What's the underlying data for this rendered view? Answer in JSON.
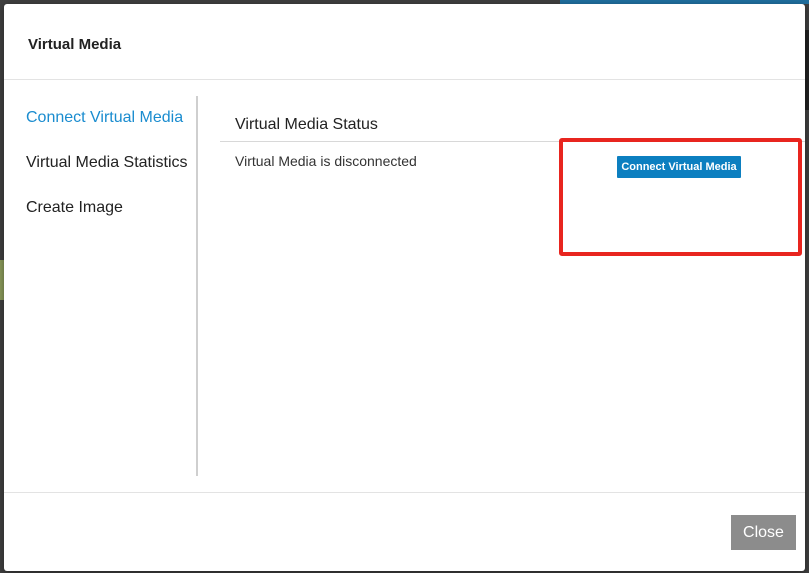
{
  "modal": {
    "title": "Virtual Media"
  },
  "sidebar": {
    "items": [
      {
        "label": "Connect Virtual Media",
        "active": true
      },
      {
        "label": "Virtual Media Statistics",
        "active": false
      },
      {
        "label": "Create Image",
        "active": false
      }
    ]
  },
  "main": {
    "section_title": "Virtual Media Status",
    "status_text": "Virtual Media is disconnected",
    "connect_button_label": "Connect Virtual Media"
  },
  "footer": {
    "close_label": "Close"
  },
  "colors": {
    "accent": "#1a8ccf",
    "button_primary": "#0c7fc0",
    "button_close": "#8c8c8c",
    "highlight": "#e8251f"
  }
}
